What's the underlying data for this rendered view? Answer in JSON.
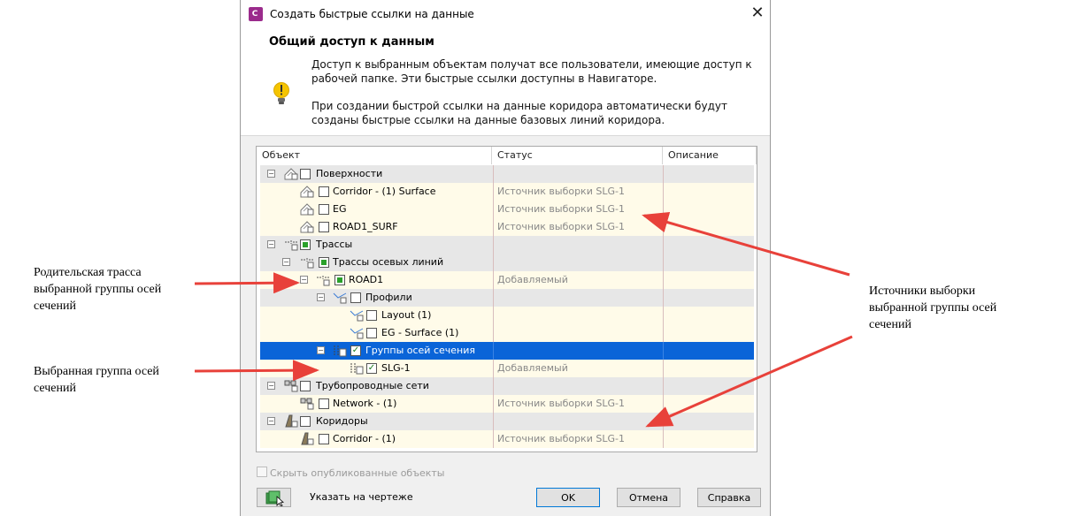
{
  "window": {
    "app_icon": "C ",
    "title": "Создать быстрые ссылки на данные",
    "close_glyph": "✕"
  },
  "header": {
    "title": "Общий доступ к данным",
    "paragraph1_line1": "Доступ к выбранным объектам получат все пользователи, имеющие доступ к",
    "paragraph1_line2": "рабочей папке. Эти быстрые ссылки доступны в Навигаторе.",
    "paragraph2_line1": "При создании быстрой ссылки на данные коридора автоматически будут",
    "paragraph2_line2": "созданы быстрые ссылки на данные базовых линий коридора."
  },
  "table": {
    "columns": [
      "Объект",
      "Статус",
      "Описание"
    ],
    "rows": [
      {
        "label": "Поверхности",
        "status": "",
        "kind": "cat",
        "icon": "surfaces-icon"
      },
      {
        "label": "Corridor - (1) Surface",
        "status": "Источник выборки SLG-1",
        "kind": "leaf",
        "icon": "surface-icon"
      },
      {
        "label": "EG",
        "status": "Источник выборки SLG-1",
        "kind": "leaf",
        "icon": "surface-icon"
      },
      {
        "label": "ROAD1_SURF",
        "status": "Источник выборки SLG-1",
        "kind": "leaf",
        "icon": "surface-icon"
      },
      {
        "label": "Трассы",
        "status": "",
        "kind": "cat",
        "icon": "alignments-icon"
      },
      {
        "label": "Трассы осевых линий",
        "status": "",
        "kind": "cat",
        "icon": "centerline-alignments-icon"
      },
      {
        "label": "ROAD1",
        "status": "Добавляемый",
        "kind": "leaf",
        "icon": "alignment-icon"
      },
      {
        "label": "Профили",
        "status": "",
        "kind": "cat",
        "icon": "profiles-icon"
      },
      {
        "label": "Layout (1)",
        "status": "",
        "kind": "leaf",
        "icon": "profile-icon"
      },
      {
        "label": "EG - Surface (1)",
        "status": "",
        "kind": "leaf",
        "icon": "profile-icon"
      },
      {
        "label": "Группы осей сечения",
        "status": "",
        "kind": "sel",
        "icon": "sample-line-groups-icon"
      },
      {
        "label": "SLG-1",
        "status": "Добавляемый",
        "kind": "leaf",
        "icon": "sample-line-group-icon"
      },
      {
        "label": "Трубопроводные сети",
        "status": "",
        "kind": "cat",
        "icon": "pipe-networks-icon"
      },
      {
        "label": "Network - (1)",
        "status": "Источник выборки SLG-1",
        "kind": "leaf",
        "icon": "pipe-network-icon"
      },
      {
        "label": "Коридоры",
        "status": "",
        "kind": "cat",
        "icon": "corridors-icon"
      },
      {
        "label": "Corridor - (1)",
        "status": "Источник выборки SLG-1",
        "kind": "leaf",
        "icon": "corridor-icon"
      }
    ]
  },
  "footer": {
    "hide_published_label": "Скрыть опубликованные объекты",
    "pick_in_drawing_label": "Указать на чертеже",
    "ok_label": "OK",
    "cancel_label": "Отмена",
    "help_label": "Справка"
  },
  "annotations": {
    "parent_alignment": [
      "Родительская трасса",
      "выбранной группы осей",
      "сечений"
    ],
    "selected_group": [
      "Выбранная группа осей",
      "сечений"
    ],
    "sample_sources": [
      "Источники выборки",
      "выбранной группы осей",
      "сечений"
    ]
  },
  "colors": {
    "selection": "#0a64d8",
    "arrow": "#e8413a",
    "category_row": "#e7e7e7",
    "leaf_row": "#fffbe9"
  }
}
